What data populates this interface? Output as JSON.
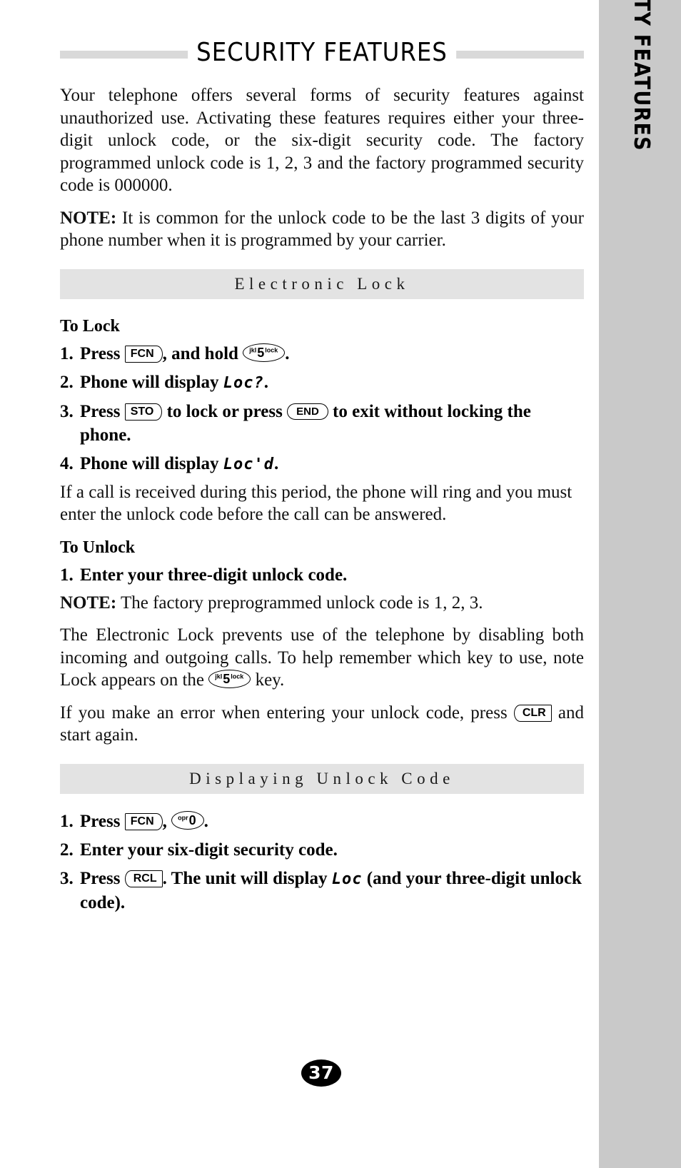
{
  "page": {
    "title": "SECURITY FEATURES",
    "number": "37",
    "side_tab_label": "SECURITY FEATURES"
  },
  "intro": {
    "paragraph": "Your telephone offers several forms of security features against unauthorized use. Activating these features requires either your three-digit unlock code, or the six-digit security code. The factory programmed unlock code is 1, 2, 3 and the factory programmed security code is 000000.",
    "note_label": "NOTE:",
    "note_text": " It is common for the unlock code to be the last 3 digits of your phone number when it is programmed by your carrier."
  },
  "sections": [
    {
      "heading": "Electronic Lock",
      "to_lock_label": "To Lock",
      "to_unlock_label": "To Unlock",
      "steps_lock": [
        {
          "num": "1.",
          "pre": "Press ",
          "key1": "FCN",
          "mid": ", and hold ",
          "key2_top": "jkl",
          "key2_digit": "5",
          "key2_bottom": "lock",
          "post": "."
        },
        {
          "num": "2.",
          "pre": "Phone will display ",
          "lcd": "Loc?",
          "post": "."
        },
        {
          "num": "3.",
          "pre": "Press ",
          "key1": "STO",
          "mid": " to lock or press ",
          "key2": "END",
          "post": " to exit without locking the phone."
        },
        {
          "num": "4.",
          "pre": "Phone will display ",
          "lcd": "Loc'd",
          "post": "."
        }
      ],
      "after_lock_text": "If a call is received during this period, the phone will ring and you must enter the unlock code before the call can be answered.",
      "steps_unlock": [
        {
          "num": "1.",
          "text": "Enter your three-digit unlock code."
        }
      ],
      "note2_label": "NOTE:",
      "note2_text": " The factory preprogrammed unlock code is 1, 2, 3.",
      "explain_pre": "The Electronic Lock prevents use of the telephone by disabling both incoming and outgoing calls. To help remember which key to use, note Lock appears on the ",
      "explain_key_top": "jkl",
      "explain_key_digit": "5",
      "explain_key_bottom": "lock",
      "explain_post": " key.",
      "error_pre": "If you make an error when entering your unlock code, press ",
      "error_key": "CLR",
      "error_post": " and start again."
    },
    {
      "heading": "Displaying Unlock Code",
      "steps": [
        {
          "num": "1.",
          "pre": "Press ",
          "key1": "FCN",
          "mid": ", ",
          "key2_top": "opr",
          "key2_digit": "0",
          "post": "."
        },
        {
          "num": "2.",
          "text": "Enter your six-digit security code."
        },
        {
          "num": "3.",
          "pre": "Press ",
          "key1": "RCL",
          "mid": ". The unit will display ",
          "lcd": "Loc",
          "post": " (and your three-digit unlock code)."
        }
      ]
    }
  ],
  "colors": {
    "title_rule": "#d9d9d9",
    "section_band": "#e3e3e3",
    "side_tab": "#c9c9c9",
    "page_badge": "#000000"
  }
}
